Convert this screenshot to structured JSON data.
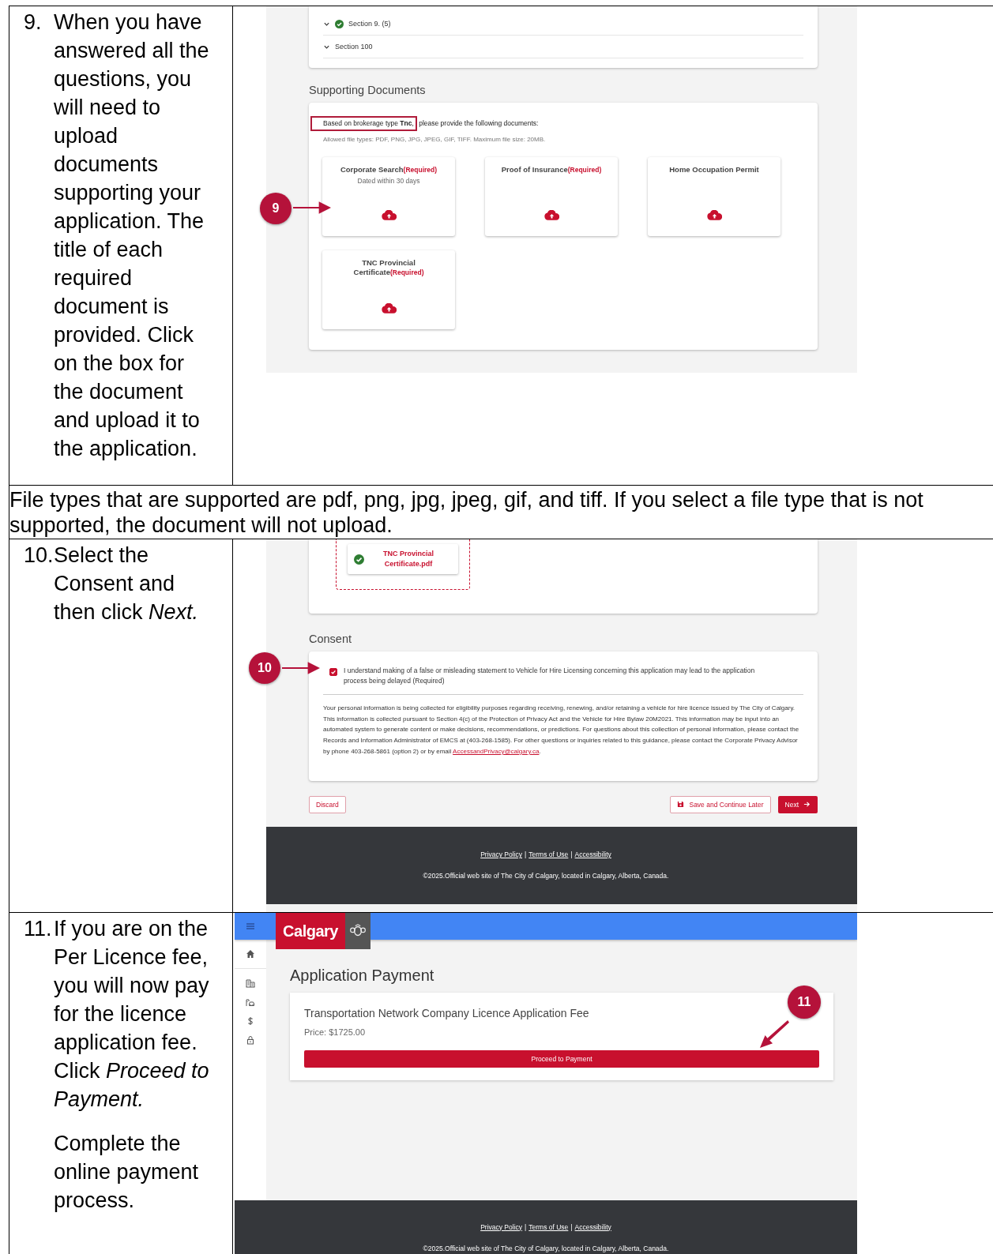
{
  "steps": [
    {
      "kind": "step",
      "number": "9.",
      "paragraphs": [
        "When you have answered all the questions, you will need to upload documents supporting your application. The title of each required document is provided. Click on the box for the document and upload it to the application."
      ],
      "screenshot": {
        "kind": "documents",
        "callout": "9",
        "sections": [
          {
            "label": "Section 9. (5)",
            "done": true
          },
          {
            "label": "Section 100",
            "done": false
          }
        ],
        "heading": "Supporting Documents",
        "intro_marked": "Based on brokerage type **Tnc**,",
        "intro_rest": " please provide the following documents:",
        "allowed": "Allowed file types: PDF, PNG, JPG, JPEG, GIF, TIFF. Maximum file size: 20MB.",
        "documents": [
          {
            "title": "Corporate Search",
            "tag": "(Required)",
            "note": "Dated within 30 days"
          },
          {
            "title": "Proof of Insurance",
            "tag": "(Required)"
          },
          {
            "title": "Home Occupation Permit"
          },
          {
            "title": "TNC Provincial Certificate",
            "tag": "(Required)"
          }
        ]
      }
    },
    {
      "kind": "note",
      "text": "File types that are supported are pdf, png, jpg, jpeg, gif, and tiff. If you select a file type that is not supported, the document will not upload."
    },
    {
      "kind": "step",
      "number": "10.",
      "paragraphs": [
        "Select the Consent and then click *Next.*"
      ],
      "screenshot": {
        "kind": "consent",
        "callout": "10",
        "uploaded_file": "TNC Provincial Certificate.pdf",
        "heading": "Consent",
        "consent": {
          "label": "I understand making of a false or misleading statement to Vehicle for Hire Licensing concerning this application may lead to the application process being delayed (Required)",
          "checked": true
        },
        "privacy_text": "Your personal information is being collected for eligibility purposes regarding receiving, renewing, and/or retaining a vehicle for hire licence issued by The City of Calgary. This information is collected pursuant to Section 4(c) of the Protection of Privacy Act and the Vehicle for Hire Bylaw 20M2021. This information may be input into an automated system to generate content or make decisions, recommendations, or predictions. For questions about this collection of personal information, please contact the Records and Information Administrator of EMCS at (403-268-1585). For other questions or inquiries related to this guidance, please contact the Corporate Privacy Advisor by phone 403-268-5861 (option 2) or by email",
        "privacy_link": "AccessandPrivacy@calgary.ca",
        "privacy_end": ".",
        "discard": "Discard",
        "save": "Save and Continue Later",
        "next": "Next",
        "footer": {
          "links": [
            "Privacy Policy",
            "Terms of Use",
            "Accessibility"
          ],
          "separator": "|",
          "copyright": "©2025.Official web site of The City of Calgary, located in Calgary, Alberta, Canada."
        }
      }
    },
    {
      "kind": "step",
      "number": "11.",
      "paragraphs": [
        "If you are on the Per Licence fee, you will now pay for the licence application fee. Click *Proceed to Payment.*",
        "Complete the online payment process."
      ],
      "screenshot": {
        "kind": "payment",
        "callout": "11",
        "logo": "Calgary",
        "heading": "Application Payment",
        "fee_title": "Transportation Network Company Licence Application Fee",
        "price": "Price: $1725.00",
        "pay": "Proceed to Payment",
        "footer": {
          "links": [
            "Privacy Policy",
            "Terms of Use",
            "Accessibility"
          ],
          "separator": "|",
          "copyright": "©2025.Official web site of The City of Calgary, located in Calgary, Alberta, Canada."
        }
      }
    }
  ]
}
